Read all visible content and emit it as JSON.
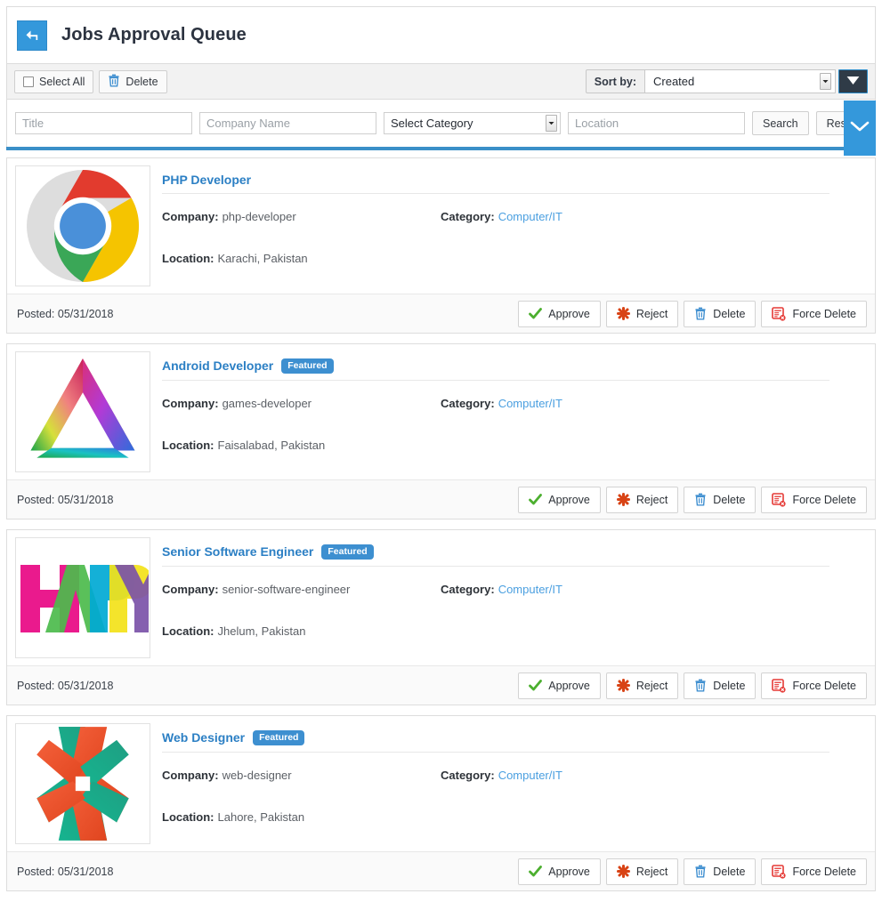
{
  "header": {
    "back_icon": "back-arrow-icon",
    "title": "Jobs Approval Queue"
  },
  "toolbar": {
    "select_all_label": "Select All",
    "select_all_checked": false,
    "delete_label": "Delete",
    "delete_icon": "trash-icon",
    "sort_by_label": "Sort by:",
    "sort_value": "Created",
    "sort_options": [
      "Created"
    ],
    "sort_direction_icon": "triangle-down-icon"
  },
  "search": {
    "title_placeholder": "Title",
    "title_value": "",
    "company_placeholder": "Company Name",
    "company_value": "",
    "category_value": "Select Category",
    "category_options": [
      "Select Category"
    ],
    "location_placeholder": "Location",
    "location_value": "",
    "search_label": "Search",
    "reset_label": "Reset",
    "collapse_icon": "chevron-down-icon"
  },
  "labels": {
    "company": "Company:",
    "category": "Category:",
    "location": "Location:",
    "featured": "Featured",
    "approve": "Approve",
    "reject": "Reject",
    "delete": "Delete",
    "force_delete": "Force Delete",
    "approve_icon": "check-icon",
    "reject_icon": "x-cross-icon",
    "delete_icon": "trash-icon",
    "force_delete_icon": "form-delete-icon"
  },
  "jobs": [
    {
      "title": "PHP Developer",
      "featured": false,
      "company": "php-developer",
      "category": "Computer/IT",
      "location": "Karachi, Pakistan",
      "posted": "Posted: 05/31/2018",
      "logo": "chrome-logo"
    },
    {
      "title": "Android Developer",
      "featured": true,
      "company": "games-developer",
      "category": "Computer/IT",
      "location": "Faisalabad, Pakistan",
      "posted": "Posted: 05/31/2018",
      "logo": "rainbow-triangle-logo"
    },
    {
      "title": "Senior Software Engineer",
      "featured": true,
      "company": "senior-software-engineer",
      "category": "Computer/IT",
      "location": "Jhelum, Pakistan",
      "posted": "Posted: 05/31/2018",
      "logo": "happy-wordmark-logo"
    },
    {
      "title": "Web Designer",
      "featured": true,
      "company": "web-designer",
      "category": "Computer/IT",
      "location": "Lahore, Pakistan",
      "posted": "Posted: 05/31/2018",
      "logo": "orange-teal-ribbon-logo"
    }
  ],
  "colors": {
    "accent_blue": "#3498db",
    "link_blue": "#2b7fc4",
    "badge_blue": "#3d8fd0",
    "dark_button": "#2f3b47",
    "approve_green": "#4caf2f",
    "reject_red": "#d84315",
    "delete_blue": "#3f8fd0",
    "force_delete_red": "#e53935",
    "rule_blue": "#3a8fc8"
  }
}
